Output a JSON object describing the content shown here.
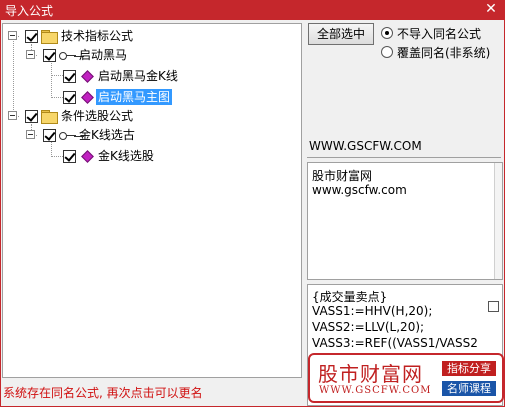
{
  "window": {
    "title": "导入公式",
    "close_glyph": "✕"
  },
  "tree": {
    "nodes": [
      {
        "label": "技术指标公式",
        "icon": "folder-icon",
        "checked": true,
        "level": 0
      },
      {
        "label": "启动黑马",
        "icon": "key-icon",
        "checked": true,
        "level": 1
      },
      {
        "label": "启动黑马金K线",
        "icon": "gem-icon",
        "checked": true,
        "level": 2
      },
      {
        "label": "启动黑马主图",
        "icon": "gem-icon",
        "checked": true,
        "level": 2,
        "selected": true
      },
      {
        "label": "条件选股公式",
        "icon": "folder-icon",
        "checked": true,
        "level": 0
      },
      {
        "label": "金K线选古",
        "icon": "key-icon",
        "checked": true,
        "level": 1
      },
      {
        "label": "金K线选股",
        "icon": "gem-icon",
        "checked": true,
        "level": 2
      }
    ]
  },
  "controls": {
    "select_all_label": "全部选中",
    "radio_no_import_label": "不导入同名公式",
    "radio_overwrite_label": "覆盖同名(非系统)",
    "radio_selected": "no_import"
  },
  "site_label": "WWW.GSCFW.COM",
  "description": {
    "line1": "股市财富网",
    "line2": "www.gscfw.com"
  },
  "code": {
    "lines": [
      "{成交量卖点}",
      "VASS1:=HHV(H,20);",
      "VASS2:=LLV(L,20);",
      "VASS3:=REF((VASS1/VASS2"
    ]
  },
  "watermark": {
    "title": "股市财富网",
    "url": "WWW.GSCFW.COM",
    "tag1": "指标分享",
    "tag2": "名师课程"
  },
  "status": {
    "message": "系统存在同名公式, 再次点击可以更名"
  },
  "colors": {
    "titlebar": "#c5272c",
    "selection": "#3399ff",
    "status_text": "#d01010"
  }
}
